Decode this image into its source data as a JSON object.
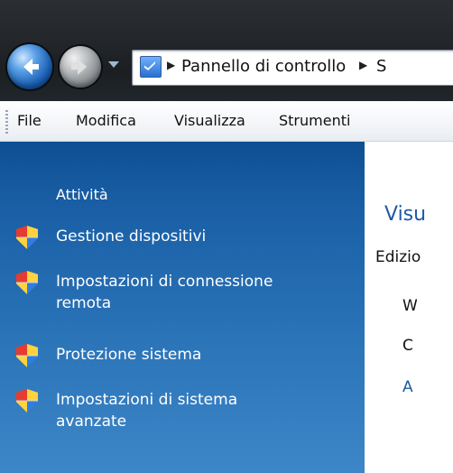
{
  "address_bar": {
    "breadcrumb": [
      "Pannello di controllo",
      "S"
    ]
  },
  "menu": {
    "items": [
      {
        "label": "File"
      },
      {
        "label": "Modifica"
      },
      {
        "label": "Visualizza"
      },
      {
        "label": "Strumenti"
      }
    ]
  },
  "tasks": {
    "title": "Attività",
    "links": [
      {
        "line1": "Gestione dispositivi",
        "line2": ""
      },
      {
        "line1": "Impostazioni di connessione",
        "line2": "remota"
      },
      {
        "line1": "Protezione sistema",
        "line2": ""
      },
      {
        "line1": "Impostazioni di sistema",
        "line2": "avanzate"
      }
    ]
  },
  "content": {
    "title": "Visu",
    "subtitle": "Edizio",
    "lines": [
      "W",
      "C"
    ],
    "link": "A"
  },
  "colors": {
    "taskpane_top": "#0e4f92",
    "taskpane_bottom": "#3d86c7",
    "link_blue": "#1c5aa6"
  },
  "icons": {
    "back": "back-arrow-icon",
    "forward": "forward-arrow-icon",
    "address": "computer-icon",
    "task": "uac-shield-icon"
  }
}
